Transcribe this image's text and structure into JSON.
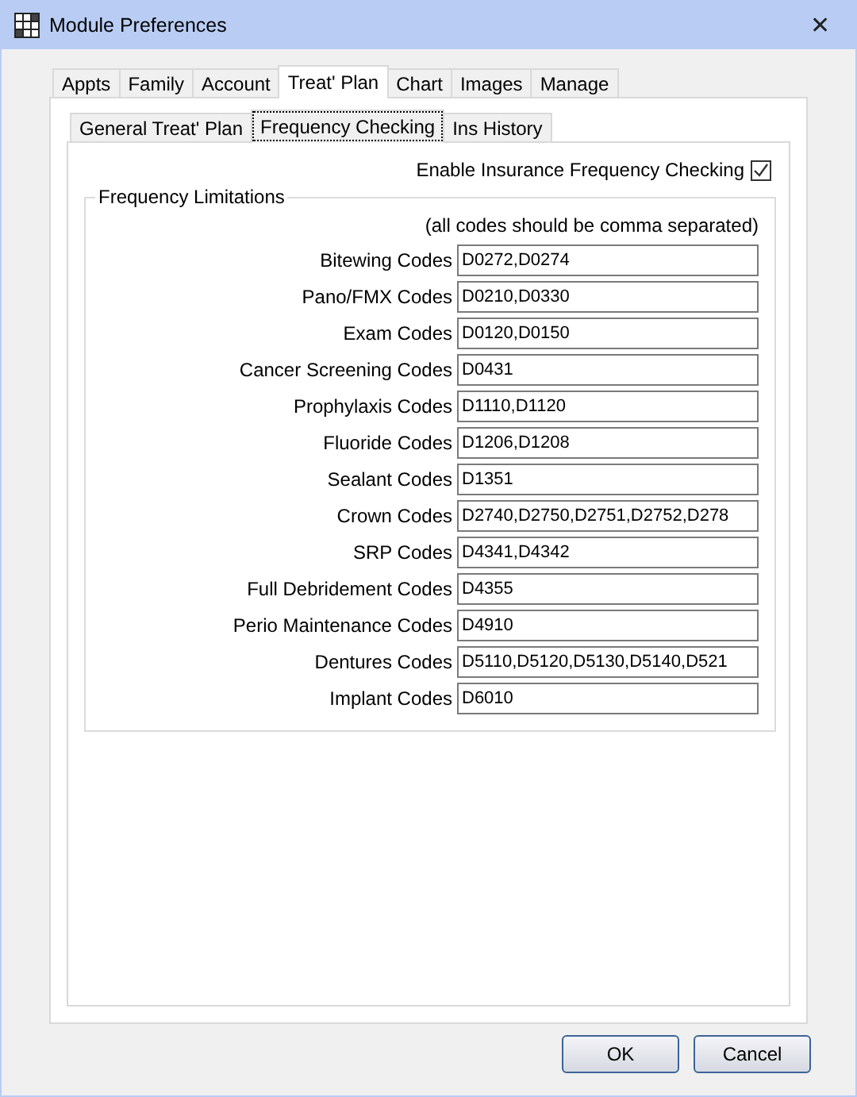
{
  "window": {
    "title": "Module Preferences",
    "close": "✕"
  },
  "tabs": [
    {
      "label": "Appts",
      "selected": false
    },
    {
      "label": "Family",
      "selected": false
    },
    {
      "label": "Account",
      "selected": false
    },
    {
      "label": "Treat' Plan",
      "selected": true
    },
    {
      "label": "Chart",
      "selected": false
    },
    {
      "label": "Images",
      "selected": false
    },
    {
      "label": "Manage",
      "selected": false
    }
  ],
  "subtabs": [
    {
      "label": "General Treat' Plan",
      "selected": false
    },
    {
      "label": "Frequency Checking",
      "selected": true
    },
    {
      "label": "Ins History",
      "selected": false
    }
  ],
  "enable_checkbox": {
    "label": "Enable Insurance Frequency Checking",
    "checked": true
  },
  "group": {
    "title": "Frequency Limitations",
    "hint": "(all codes should be comma separated)",
    "fields": [
      {
        "label": "Bitewing Codes",
        "value": "D0272,D0274"
      },
      {
        "label": "Pano/FMX Codes",
        "value": "D0210,D0330"
      },
      {
        "label": "Exam Codes",
        "value": "D0120,D0150"
      },
      {
        "label": "Cancer Screening Codes",
        "value": "D0431"
      },
      {
        "label": "Prophylaxis Codes",
        "value": "D1110,D1120"
      },
      {
        "label": "Fluoride Codes",
        "value": "D1206,D1208"
      },
      {
        "label": "Sealant Codes",
        "value": "D1351"
      },
      {
        "label": "Crown Codes",
        "value": "D2740,D2750,D2751,D2752,D278"
      },
      {
        "label": "SRP Codes",
        "value": "D4341,D4342"
      },
      {
        "label": "Full Debridement Codes",
        "value": "D4355"
      },
      {
        "label": "Perio Maintenance Codes",
        "value": "D4910"
      },
      {
        "label": "Dentures Codes",
        "value": "D5110,D5120,D5130,D5140,D521"
      },
      {
        "label": "Implant Codes",
        "value": "D6010"
      }
    ]
  },
  "buttons": [
    "OK",
    "Cancel"
  ]
}
